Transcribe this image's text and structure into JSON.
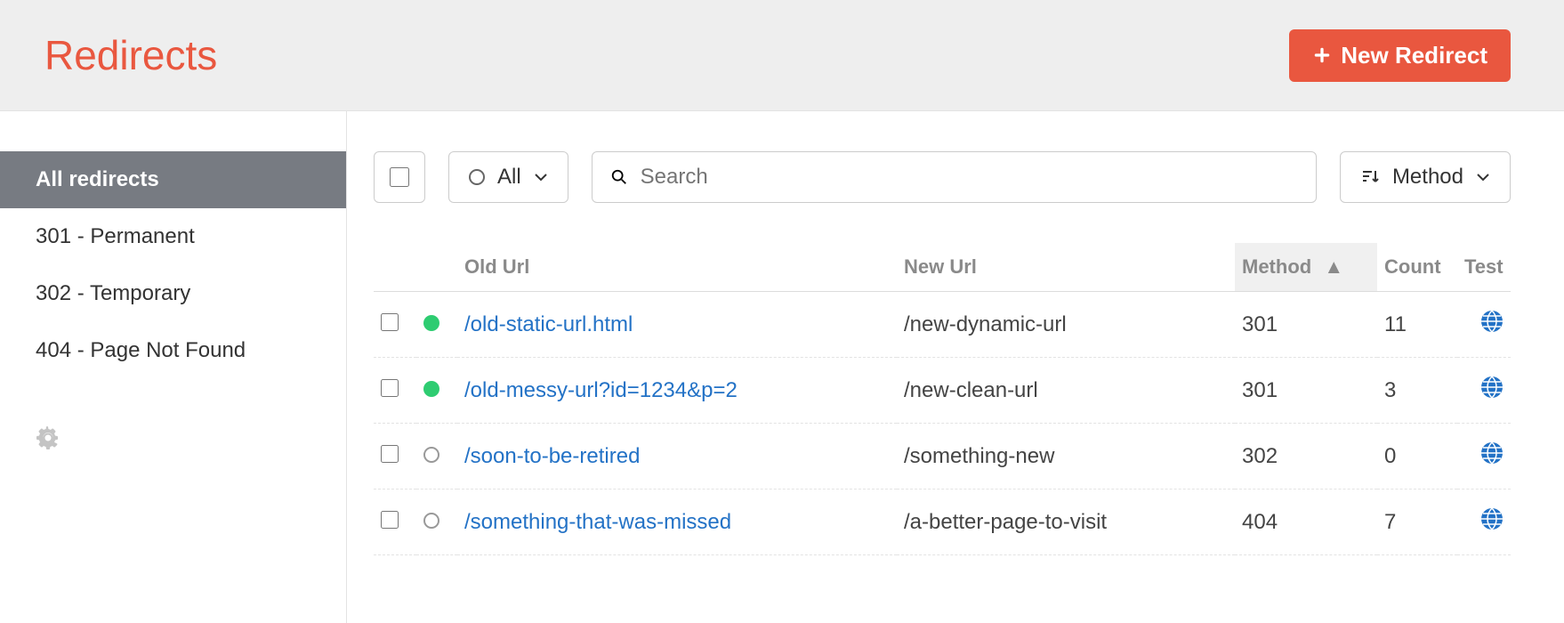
{
  "header": {
    "title": "Redirects",
    "new_button_label": "New Redirect"
  },
  "sidebar": {
    "items": [
      {
        "label": "All redirects",
        "active": true
      },
      {
        "label": "301 - Permanent",
        "active": false
      },
      {
        "label": "302 - Temporary",
        "active": false
      },
      {
        "label": "404 - Page Not Found",
        "active": false
      }
    ]
  },
  "toolbar": {
    "filter_label": "All",
    "search_placeholder": "Search",
    "sort_label": "Method"
  },
  "table": {
    "columns": {
      "old_url": "Old Url",
      "new_url": "New Url",
      "method": "Method",
      "count": "Count",
      "test": "Test"
    },
    "sort_indicator": "▲",
    "rows": [
      {
        "status": "active",
        "old_url": "/old-static-url.html",
        "new_url": "/new-dynamic-url",
        "method": "301",
        "count": "11"
      },
      {
        "status": "active",
        "old_url": "/old-messy-url?id=1234&p=2",
        "new_url": "/new-clean-url",
        "method": "301",
        "count": "3"
      },
      {
        "status": "inactive",
        "old_url": "/soon-to-be-retired",
        "new_url": "/something-new",
        "method": "302",
        "count": "0"
      },
      {
        "status": "inactive",
        "old_url": "/something-that-was-missed",
        "new_url": "/a-better-page-to-visit",
        "method": "404",
        "count": "7"
      }
    ]
  }
}
